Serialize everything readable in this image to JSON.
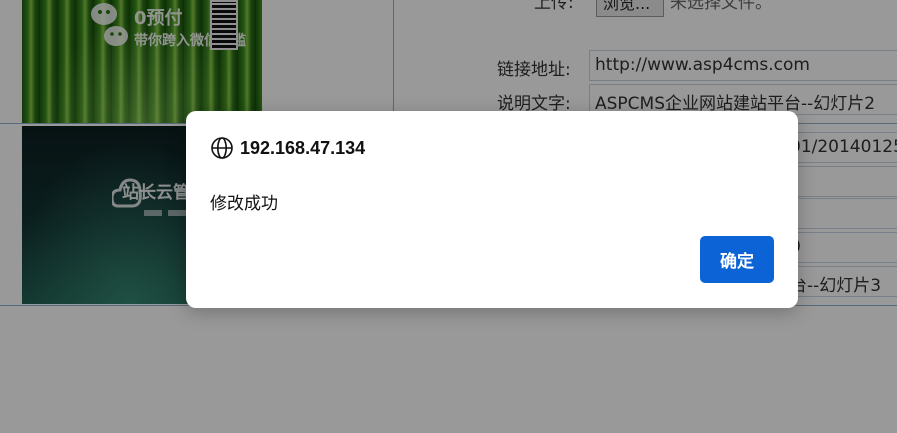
{
  "background_page": {
    "upload": {
      "label": "上传:",
      "browse_button": "浏览...",
      "file_status": "未选择文件。"
    },
    "rows": [
      {
        "thumbnail_text_1": "0预付",
        "thumbnail_text_2": "带你跨入微信门槛",
        "link_label": "链接地址:",
        "link_value": "http://www.asp4cms.com",
        "desc_label": "说明文字:",
        "desc_value": "ASPCMS企业网站建站平台--幻灯片2"
      },
      {
        "thumbnail_text": "站长云管理平台",
        "path_value_fragment": "01/20140125",
        "link_value_fragment": "0",
        "desc_value_fragment": "台--幻灯片3"
      }
    ]
  },
  "dialog": {
    "icon": "globe-icon",
    "origin": "192.168.47.134",
    "message": "修改成功",
    "ok_label": "确定",
    "button_color": "#0b63d6"
  },
  "colors": {
    "overlay": "rgba(0,0,0,0.40)",
    "table_border": "#8fb3cf"
  }
}
